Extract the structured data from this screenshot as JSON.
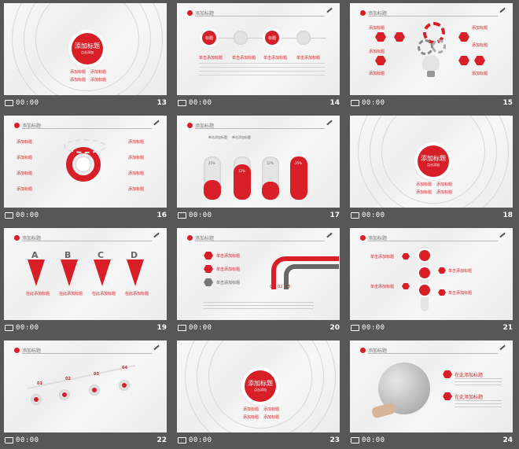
{
  "slides": [
    {
      "num": "13",
      "time": "00:00",
      "title": "添加标题",
      "sub": "点击添加",
      "b1": "添加标题",
      "b2": "添加标题",
      "b3": "添加标题",
      "b4": "添加标题"
    },
    {
      "num": "14",
      "time": "00:00",
      "header": "添加标题",
      "labels": [
        "标题",
        "",
        "标题",
        ""
      ],
      "t1": "单击添加标题",
      "t2": "单击添加标题",
      "t3": "单击添加标题",
      "t4": "单击添加标题"
    },
    {
      "num": "15",
      "time": "00:00",
      "header": "添加标题",
      "t1": "添加标题",
      "t2": "添加标题",
      "t3": "添加标题",
      "t4": "添加标题",
      "t5": "添加标题",
      "t6": "添加标题"
    },
    {
      "num": "16",
      "time": "00:00",
      "header": "添加标题",
      "l1": "添加标题",
      "l2": "添加标题",
      "l3": "添加标题",
      "l4": "添加标题",
      "r1": "添加标题",
      "r2": "添加标题",
      "r3": "添加标题",
      "r4": "添加标题"
    },
    {
      "num": "17",
      "time": "00:00",
      "header": "添加标题",
      "p1": "25%",
      "p2": "12%",
      "p3": "12%",
      "p4": "35%",
      "n1": "单击添加标题",
      "n2": "单击添加标题"
    },
    {
      "num": "18",
      "time": "00:00",
      "title": "添加标题",
      "sub": "点击添加",
      "b1": "添加标题",
      "b2": "添加标题",
      "b3": "添加标题",
      "b4": "添加标题"
    },
    {
      "num": "19",
      "time": "00:00",
      "header": "添加标题",
      "letters": [
        "A",
        "B",
        "C",
        "D"
      ],
      "t1": "在此添加标题",
      "t2": "在此添加标题",
      "t3": "在此添加标题",
      "t4": "在此添加标题"
    },
    {
      "num": "20",
      "time": "00:00",
      "header": "添加标题",
      "t1": "单击添加标题",
      "t2": "单击添加标题",
      "t3": "单击添加标题",
      "s1": "01",
      "s2": "02",
      "s3": "03"
    },
    {
      "num": "21",
      "time": "00:00",
      "header": "添加标题",
      "t1": "单击添加标题",
      "t2": "单击添加标题",
      "t3": "单击添加标题",
      "t4": "单击添加标题"
    },
    {
      "num": "22",
      "time": "00:00",
      "header": "添加标题",
      "s1": "01",
      "s2": "02",
      "s3": "03",
      "s4": "04"
    },
    {
      "num": "23",
      "time": "00:00",
      "title": "添加标题",
      "sub": "点击添加",
      "b1": "添加标题",
      "b2": "添加标题",
      "b3": "添加标题",
      "b4": "添加标题"
    },
    {
      "num": "24",
      "time": "00:00",
      "header": "添加标题",
      "t1": "在此添加标题",
      "t2": "在此添加标题"
    }
  ]
}
